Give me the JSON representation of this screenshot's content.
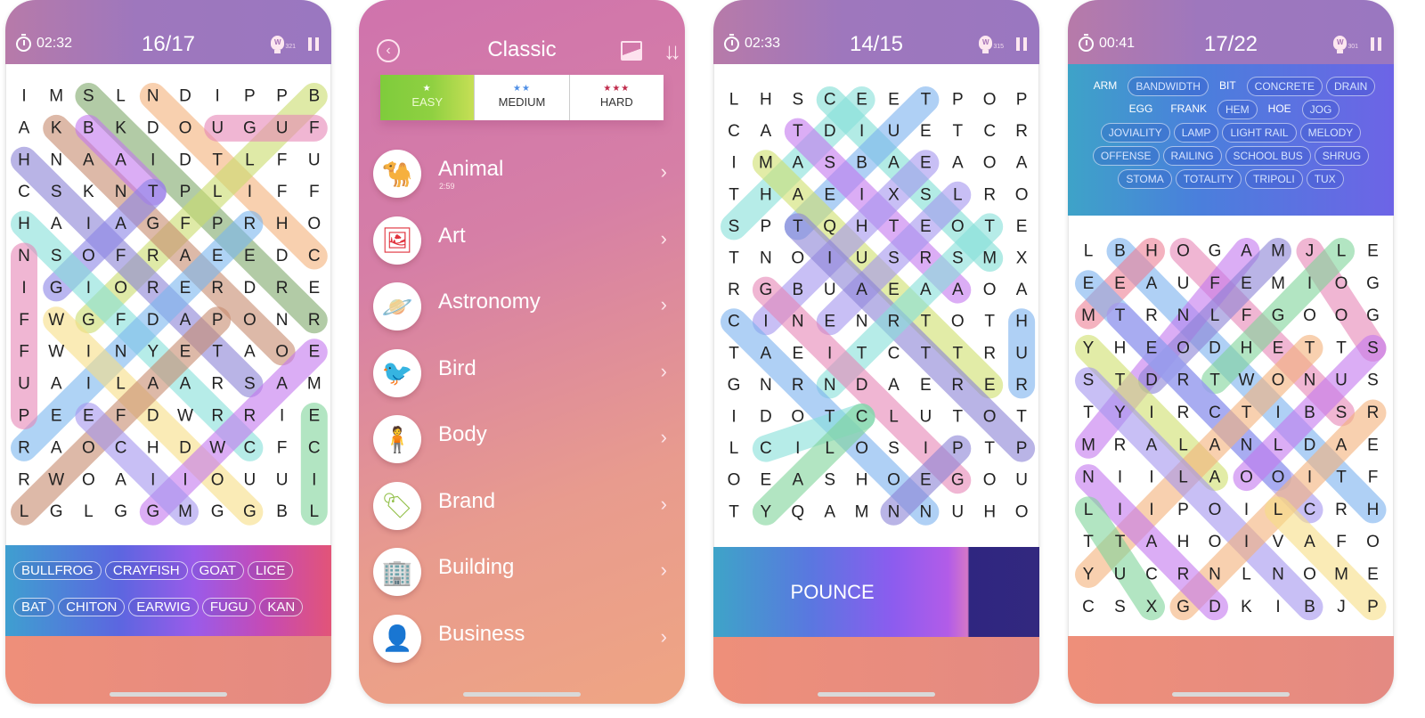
{
  "screens": [
    {
      "id": "game1",
      "timer": "02:32",
      "progress": "16/17",
      "hint_count": "321",
      "hint_letter": "W",
      "grid": [
        "IMSLNDIPPB",
        "AKBKDOUGUF",
        "HNAAIDTLFU",
        "CSKNTPLIFF",
        "HAIAGFPRHO",
        "NSOFRAEEDC",
        "IGIORERDRE",
        "FWGFDAPONR",
        "FWINYETAOE",
        "UAILAARSAM",
        "PEEFDWRRIE",
        "RAOCHDWCFC",
        "RWOAIIOUUI",
        "LGLGGMGGBL"
      ],
      "highlights": [
        {
          "from": [
            0,
            2
          ],
          "to": [
            7,
            9
          ],
          "color": "#7fa86a"
        },
        {
          "from": [
            0,
            4
          ],
          "to": [
            5,
            9
          ],
          "color": "#f3b07a"
        },
        {
          "from": [
            0,
            9
          ],
          "to": [
            7,
            2
          ],
          "color": "#c9dc6c"
        },
        {
          "from": [
            1,
            6
          ],
          "to": [
            1,
            9
          ],
          "color": "#e685b6"
        },
        {
          "from": [
            1,
            1
          ],
          "to": [
            8,
            8
          ],
          "color": "#c78a6e"
        },
        {
          "from": [
            1,
            2
          ],
          "to": [
            3,
            4
          ],
          "color": "#c377ef"
        },
        {
          "from": [
            2,
            0
          ],
          "to": [
            9,
            7
          ],
          "color": "#8b82d6"
        },
        {
          "from": [
            3,
            4
          ],
          "to": [
            6,
            1
          ],
          "color": "#8a84e6"
        },
        {
          "from": [
            4,
            0
          ],
          "to": [
            11,
            7
          ],
          "color": "#85e0d8"
        },
        {
          "from": [
            4,
            7
          ],
          "to": [
            11,
            0
          ],
          "color": "#79b5ef"
        },
        {
          "from": [
            5,
            0
          ],
          "to": [
            10,
            0
          ],
          "color": "#e685b6"
        },
        {
          "from": [
            7,
            1
          ],
          "to": [
            13,
            7
          ],
          "color": "#f7dd85"
        },
        {
          "from": [
            7,
            6
          ],
          "to": [
            13,
            0
          ],
          "color": "#c78a6e"
        },
        {
          "from": [
            8,
            9
          ],
          "to": [
            13,
            4
          ],
          "color": "#c377ef"
        },
        {
          "from": [
            10,
            2
          ],
          "to": [
            13,
            5
          ],
          "color": "#a394ef"
        },
        {
          "from": [
            10,
            9
          ],
          "to": [
            13,
            9
          ],
          "color": "#7fd49a"
        }
      ],
      "word_bank": {
        "row1": [
          "BULLFROG",
          "CRAYFISH",
          "GOAT",
          "LICE"
        ],
        "row2": [
          "BAT",
          "CHITON",
          "EARWIG",
          "FUGU",
          "KAN"
        ]
      }
    },
    {
      "id": "category-menu",
      "title": "Classic",
      "difficulty_tabs": [
        {
          "label": "EASY",
          "stars": "★",
          "star_color": "#ffffff",
          "active": true
        },
        {
          "label": "MEDIUM",
          "stars": "★★",
          "star_color": "#4f8fe6",
          "active": false
        },
        {
          "label": "HARD",
          "stars": "★★★",
          "star_color": "#c02a4b",
          "active": false
        }
      ],
      "categories": [
        {
          "label": "Animal",
          "sub": "2:59",
          "icon": "camel-icon",
          "glyph": "🐪",
          "color": "#d6448f"
        },
        {
          "label": "Art",
          "sub": "",
          "icon": "portrait-icon",
          "glyph": "🖼",
          "color": "#e0323c"
        },
        {
          "label": "Astronomy",
          "sub": "",
          "icon": "planet-icon",
          "glyph": "🪐",
          "color": "#b34f24"
        },
        {
          "label": "Bird",
          "sub": "",
          "icon": "bird-icon",
          "glyph": "🐦",
          "color": "#ef7a2b"
        },
        {
          "label": "Body",
          "sub": "",
          "icon": "body-icon",
          "glyph": "🧍",
          "color": "#f2c52a"
        },
        {
          "label": "Brand",
          "sub": "",
          "icon": "tag-icon",
          "glyph": "🏷",
          "color": "#93c04a"
        },
        {
          "label": "Building",
          "sub": "",
          "icon": "building-icon",
          "glyph": "🏢",
          "color": "#8bc34a"
        },
        {
          "label": "Business",
          "sub": "",
          "icon": "businessman-icon",
          "glyph": "👤",
          "color": "#2f6b2a"
        }
      ],
      "chevron": "›"
    },
    {
      "id": "game2",
      "timer": "02:33",
      "progress": "14/15",
      "hint_count": "315",
      "hint_letter": "W",
      "grid": [
        "LHSCEETPOP",
        "CATDIUETCR",
        "IMASBAEAOA",
        "THAEIXSLRO",
        "SPTQHTEOTE",
        "TNOIUSRSMX",
        "RGBUAEAAOA",
        "CINENRTOTH",
        "TAEITCTTRU",
        "GNRNDAERER",
        "IDOTCLUTOT",
        "LCILOSIPTP",
        "OEASHOEGOU",
        "TYQAMNNUHO"
      ],
      "highlights": [
        {
          "from": [
            0,
            3
          ],
          "to": [
            5,
            8
          ],
          "color": "#7fded4"
        },
        {
          "from": [
            0,
            6
          ],
          "to": [
            4,
            2
          ],
          "color": "#79b0ef"
        },
        {
          "from": [
            0,
            4
          ],
          "to": [
            4,
            0
          ],
          "color": "#85e0d8"
        },
        {
          "from": [
            1,
            2
          ],
          "to": [
            6,
            7
          ],
          "color": "#c377ef"
        },
        {
          "from": [
            2,
            1
          ],
          "to": [
            9,
            8
          ],
          "color": "#cfe06c"
        },
        {
          "from": [
            2,
            6
          ],
          "to": [
            7,
            1
          ],
          "color": "#a394ef"
        },
        {
          "from": [
            3,
            7
          ],
          "to": [
            7,
            3
          ],
          "color": "#a394ef"
        },
        {
          "from": [
            4,
            2
          ],
          "to": [
            11,
            9
          ],
          "color": "#8b82d6"
        },
        {
          "from": [
            4,
            8
          ],
          "to": [
            9,
            3
          ],
          "color": "#85e0d8"
        },
        {
          "from": [
            6,
            1
          ],
          "to": [
            12,
            7
          ],
          "color": "#e685b6"
        },
        {
          "from": [
            7,
            0
          ],
          "to": [
            13,
            6
          ],
          "color": "#79b0ef"
        },
        {
          "from": [
            7,
            9
          ],
          "to": [
            9,
            9
          ],
          "color": "#79b0ef"
        },
        {
          "from": [
            10,
            4
          ],
          "to": [
            11,
            1
          ],
          "color": "#85e0d8"
        },
        {
          "from": [
            10,
            4
          ],
          "to": [
            13,
            1
          ],
          "color": "#7fd49a"
        },
        {
          "from": [
            11,
            7
          ],
          "to": [
            13,
            5
          ],
          "color": "#8b82d6"
        }
      ],
      "bottom_banner": "POUNCE"
    },
    {
      "id": "game3",
      "timer": "00:41",
      "progress": "17/22",
      "hint_count": "301",
      "hint_letter": "W",
      "word_list": [
        [
          {
            "w": "ARM",
            "found": false
          },
          {
            "w": "BANDWIDTH",
            "found": true
          },
          {
            "w": "BIT",
            "found": false
          },
          {
            "w": "CONCRETE",
            "found": true
          },
          {
            "w": "DRAIN",
            "found": true
          }
        ],
        [
          {
            "w": "EGG",
            "found": false
          },
          {
            "w": "FRANK",
            "found": false
          },
          {
            "w": "HEM",
            "found": true
          },
          {
            "w": "HOE",
            "found": false
          },
          {
            "w": "JOG",
            "found": true
          }
        ],
        [
          {
            "w": "JOVIALITY",
            "found": true
          },
          {
            "w": "LAMP",
            "found": true
          },
          {
            "w": "LIGHT RAIL",
            "found": true
          },
          {
            "w": "MELODY",
            "found": true
          }
        ],
        [
          {
            "w": "OFFENSE",
            "found": true
          },
          {
            "w": "RAILING",
            "found": true
          },
          {
            "w": "SCHOOL BUS",
            "found": true
          },
          {
            "w": "SHRUG",
            "found": true
          }
        ],
        [
          {
            "w": "STOMA",
            "found": true
          },
          {
            "w": "TOTALITY",
            "found": true
          },
          {
            "w": "TRIPOLI",
            "found": true
          },
          {
            "w": "TUX",
            "found": true
          }
        ]
      ],
      "grid": [
        "LBHOGAMJLE",
        "EEAUFEMIOG",
        "MTRNLFGOOG",
        "YHEODHETTS",
        "STDRTWONUS",
        "TYIRCTIBSR",
        "MRALANLDAE",
        "NIILAOOITF",
        "LIIPOILCRH",
        "TTAHOIVAFO",
        "YUCRNLNOME",
        "CSXGDKIBJP"
      ],
      "highlights": [
        {
          "from": [
            0,
            1
          ],
          "to": [
            8,
            9
          ],
          "color": "#79b0ef"
        },
        {
          "from": [
            0,
            2
          ],
          "to": [
            2,
            0
          ],
          "color": "#ec7f95"
        },
        {
          "from": [
            0,
            3
          ],
          "to": [
            5,
            8
          ],
          "color": "#e685b6"
        },
        {
          "from": [
            0,
            5
          ],
          "to": [
            6,
            0
          ],
          "color": "#c377ef"
        },
        {
          "from": [
            0,
            6
          ],
          "to": [
            4,
            2
          ],
          "color": "#8b82d6"
        },
        {
          "from": [
            0,
            7
          ],
          "to": [
            3,
            9
          ],
          "color": "#e685b6"
        },
        {
          "from": [
            0,
            8
          ],
          "to": [
            4,
            4
          ],
          "color": "#7fd49a"
        },
        {
          "from": [
            1,
            0
          ],
          "to": [
            7,
            6
          ],
          "color": "#79b0ef"
        },
        {
          "from": [
            2,
            1
          ],
          "to": [
            8,
            7
          ],
          "color": "#a394ef"
        },
        {
          "from": [
            3,
            0
          ],
          "to": [
            7,
            4
          ],
          "color": "#cfe06c"
        },
        {
          "from": [
            3,
            9
          ],
          "to": [
            7,
            5
          ],
          "color": "#c377ef"
        },
        {
          "from": [
            3,
            7
          ],
          "to": [
            10,
            0
          ],
          "color": "#f3b07a"
        },
        {
          "from": [
            4,
            0
          ],
          "to": [
            11,
            7
          ],
          "color": "#a394ef"
        },
        {
          "from": [
            5,
            9
          ],
          "to": [
            11,
            3
          ],
          "color": "#f3b07a"
        },
        {
          "from": [
            7,
            0
          ],
          "to": [
            11,
            4
          ],
          "color": "#c377ef"
        },
        {
          "from": [
            8,
            0
          ],
          "to": [
            11,
            2
          ],
          "color": "#7fd49a"
        },
        {
          "from": [
            8,
            6
          ],
          "to": [
            11,
            9
          ],
          "color": "#f7dd85"
        }
      ]
    }
  ]
}
